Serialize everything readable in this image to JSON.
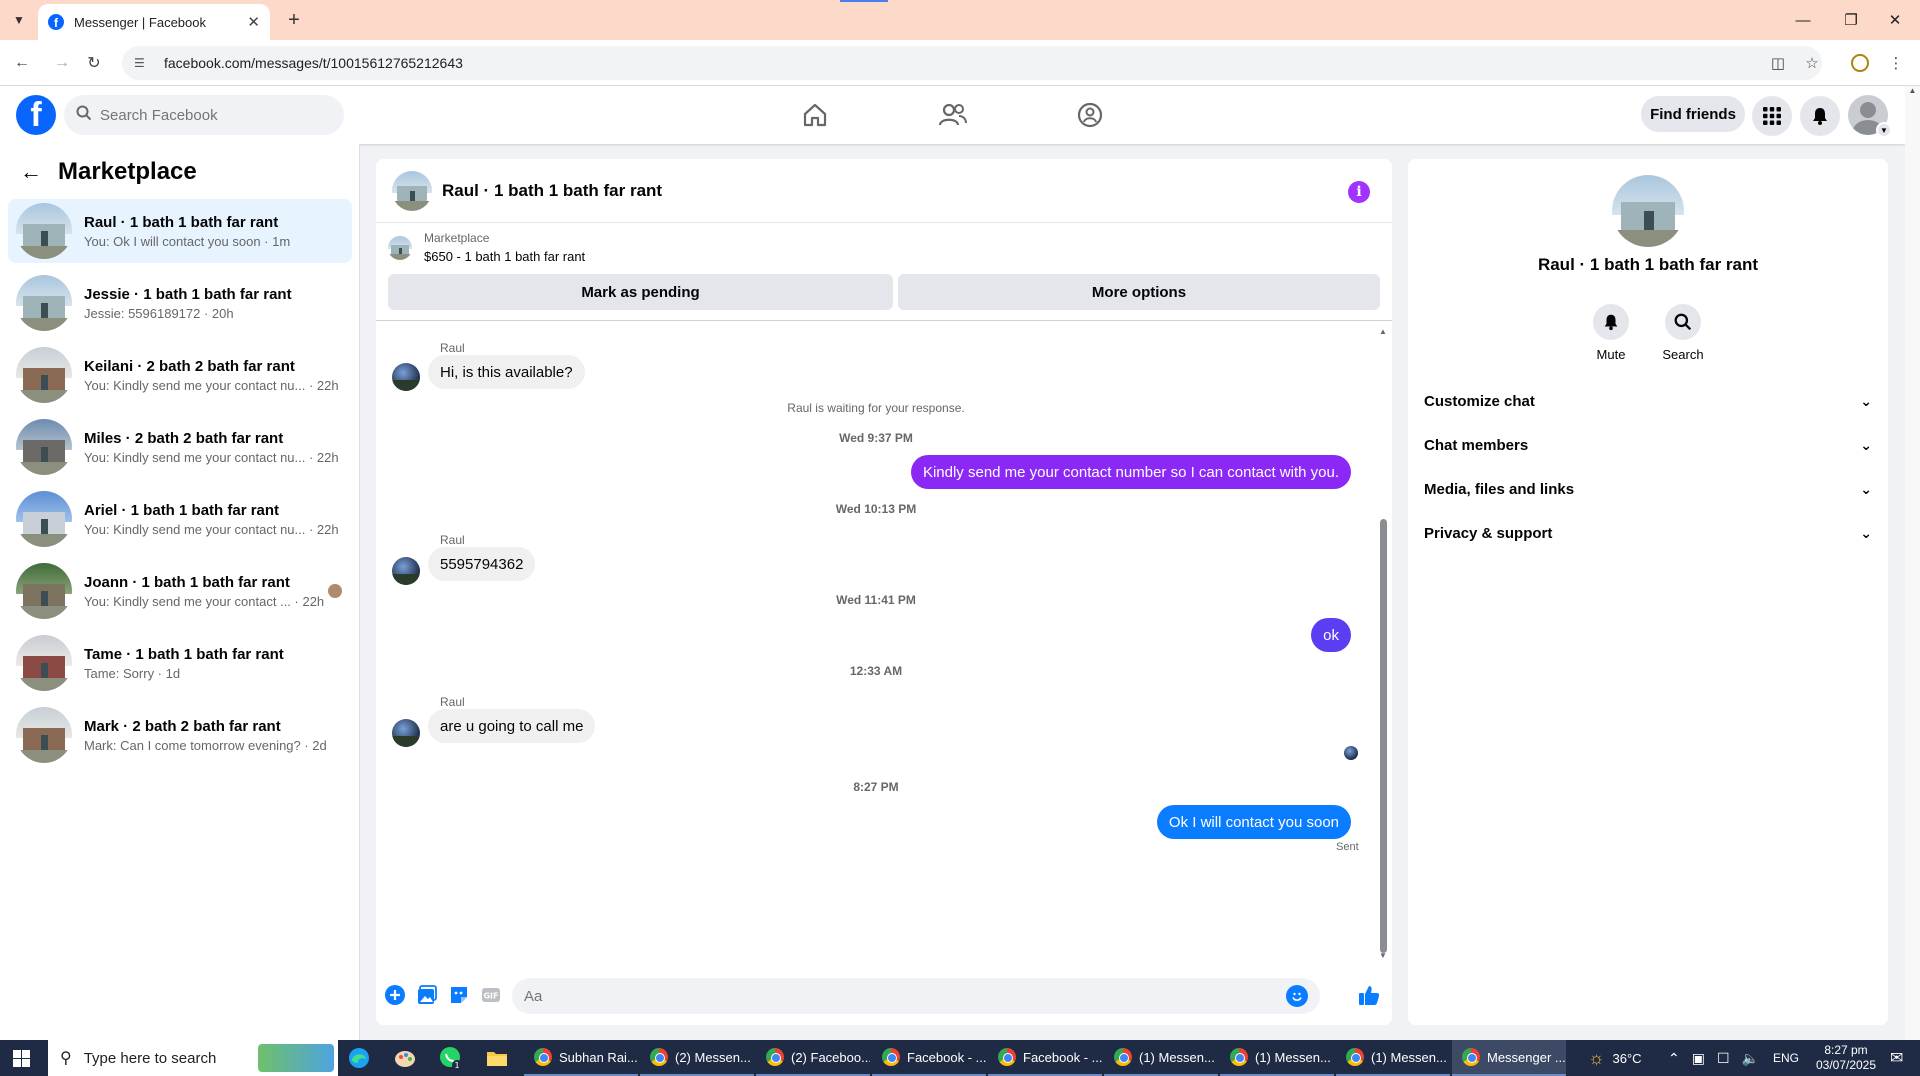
{
  "browser": {
    "tab_title": "Messenger | Facebook",
    "url": "facebook.com/messages/t/10015612765212643"
  },
  "fb": {
    "search_placeholder": "Search Facebook",
    "find_friends": "Find friends"
  },
  "sidebar": {
    "title": "Marketplace",
    "conversations": [
      {
        "name": "Raul · 1 bath 1 bath far rant",
        "preview": "You: Ok I will contact you soon · 1m"
      },
      {
        "name": "Jessie · 1 bath 1 bath far rant",
        "preview": "Jessie: 5596189172 · 20h"
      },
      {
        "name": "Keilani · 2 bath 2 bath far rant",
        "preview": "You: Kindly send me your contact nu... · 22h"
      },
      {
        "name": "Miles · 2 bath 2 bath far rant",
        "preview": "You: Kindly send me your contact nu... · 22h"
      },
      {
        "name": "Ariel · 1 bath 1 bath far rant",
        "preview": "You: Kindly send me your contact nu... · 22h"
      },
      {
        "name": "Joann · 1 bath 1 bath far rant",
        "preview": "You: Kindly send me your contact ... · 22h"
      },
      {
        "name": "Tame · 1 bath 1 bath far rant",
        "preview": "Tame: Sorry · 1d"
      },
      {
        "name": "Mark · 2 bath 2 bath far rant",
        "preview": "Mark: Can I come tomorrow evening? · 2d"
      }
    ]
  },
  "chat": {
    "title": "Raul · 1 bath 1 bath far rant",
    "listing_label": "Marketplace",
    "listing_detail": "$650 - 1 bath 1 bath far rant",
    "mark_pending": "Mark as pending",
    "more_options": "More options",
    "sender_name": "Raul",
    "messages": {
      "m1": "Hi, is this available?",
      "waiting": "Raul is waiting for your response.",
      "t1": "Wed 9:37 PM",
      "m2": "Kindly send me your contact number so I can contact with you.",
      "t2": "Wed 10:13 PM",
      "m3": "5595794362",
      "t3": "Wed 11:41 PM",
      "m4": "ok",
      "t4": "12:33 AM",
      "m5": "are u going to call me",
      "t5": "8:27 PM",
      "m6": "Ok I will contact you soon",
      "sent": "Sent"
    },
    "composer_placeholder": "Aa",
    "colors": {
      "accent_purple": "#8b28f5",
      "accent_blue": "#0a7cff"
    }
  },
  "details": {
    "name": "Raul · 1 bath 1 bath far rant",
    "mute": "Mute",
    "search": "Search",
    "sections": [
      "Customize chat",
      "Chat members",
      "Media, files and links",
      "Privacy & support"
    ]
  },
  "taskbar": {
    "search_placeholder": "Type here to search",
    "items": [
      "Subhan Rai...",
      "(2) Messen...",
      "(2) Faceboo...",
      "Facebook - ...",
      "Facebook - ...",
      "(1) Messen...",
      "(1) Messen...",
      "(1) Messen...",
      "Messenger ..."
    ],
    "temperature": "36°C",
    "lang": "ENG",
    "time": "8:27 pm",
    "date": "03/07/2025"
  }
}
